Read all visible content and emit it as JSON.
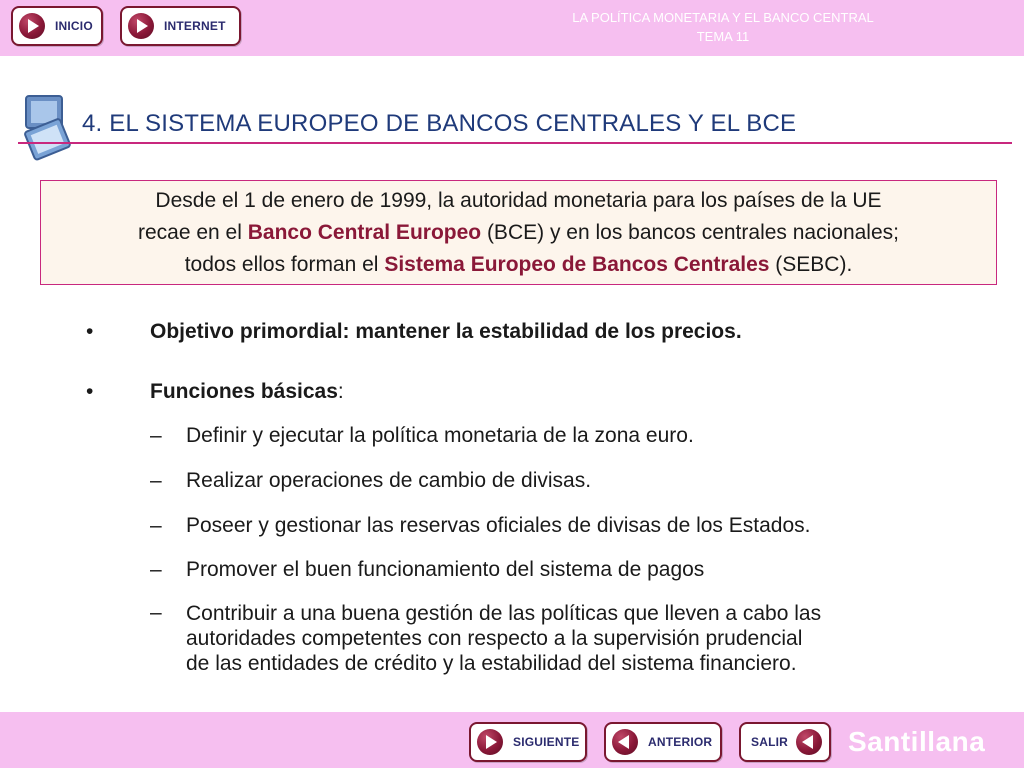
{
  "header": {
    "nav": [
      {
        "label": "INICIO"
      },
      {
        "label": "INTERNET"
      }
    ],
    "title_line1": "LA POLÍTICA MONETARIA Y EL BANCO CENTRAL",
    "title_line2": "TEMA 11"
  },
  "section": {
    "heading": "4. EL SISTEMA EUROPEO DE BANCOS CENTRALES Y EL BCE"
  },
  "infobox": {
    "line1": "Desde el 1 de enero de 1999, la autoridad monetaria para los países de la UE",
    "line2_pre": "recae en el ",
    "line2_bold": "Banco Central Europeo",
    "line2_post": " (BCE) y en los bancos centrales nacionales;",
    "line3_pre": "todos ellos forman el ",
    "line3_bold": "Sistema Europeo de Bancos Centrales",
    "line3_post": " (SEBC)."
  },
  "bullets": {
    "marker": "•",
    "objective": "Objetivo primordial: mantener la estabilidad de los precios.",
    "functions_label": "Funciones básicas",
    "functions_colon": ":"
  },
  "functions": {
    "marker": "–",
    "items": [
      "Definir y ejecutar la política monetaria de la zona euro.",
      "Realizar operaciones de cambio de divisas.",
      "Poseer y gestionar las reservas oficiales de divisas de los Estados.",
      "Promover el buen funcionamiento del sistema de pagos"
    ],
    "last_line1": "Contribuir a una buena gestión de las políticas que lleven a cabo las",
    "last_line2": "autoridades competentes con respecto a la supervisión prudencial",
    "last_line3": "de las entidades de crédito y la estabilidad del sistema financiero."
  },
  "footer": {
    "next": "SIGUIENTE",
    "prev": "ANTERIOR",
    "exit": "SALIR",
    "brand": "Santillana"
  },
  "colors": {
    "bar_pink": "#f6bff0",
    "accent_magenta": "#c8287e",
    "heading_blue": "#1f3a7a",
    "highlight_maroon": "#8a1838"
  },
  "icons": {
    "nav_forward": "play-right-icon",
    "nav_back": "play-left-icon",
    "section": "monitor-icon"
  }
}
